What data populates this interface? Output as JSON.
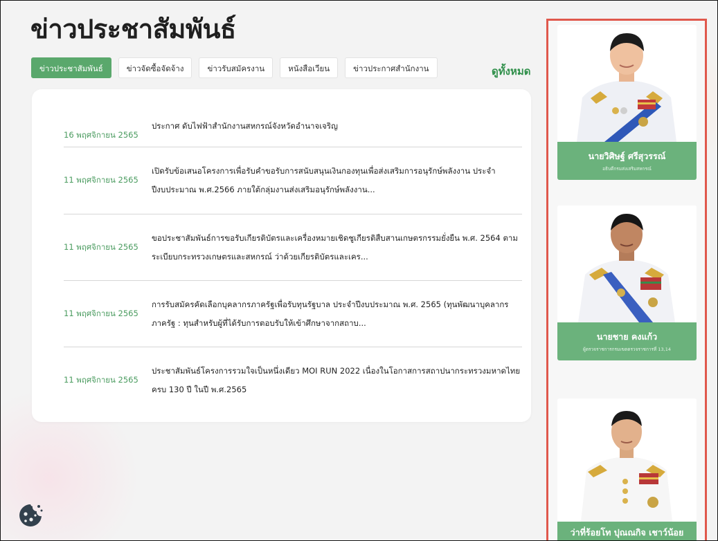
{
  "page": {
    "title": "ข่าวประชาสัมพันธ์",
    "see_all": "ดูทั้งหมด"
  },
  "tabs": [
    {
      "label": "ข่าวประชาสัมพันธ์",
      "active": true
    },
    {
      "label": "ข่าวจัดซื้อจัดจ้าง",
      "active": false
    },
    {
      "label": "ข่าวรับสมัครงาน",
      "active": false
    },
    {
      "label": "หนังสือเวียน",
      "active": false
    },
    {
      "label": "ข่าวประกาศสำนักงาน",
      "active": false
    }
  ],
  "news": [
    {
      "date": "16 พฤศจิกายน 2565",
      "title": "ประกาศ ดับไฟฟ้าสำนักงานสหกรณ์จังหวัดอำนาจเจริญ"
    },
    {
      "date": "11 พฤศจิกายน 2565",
      "title": "เปิดรับข้อเสนอโครงการเพื่อรับคำขอรับการสนับสนุนเงินกองทุนเพื่อส่งเสริมการอนุรักษ์พลังงาน ประจำปีงบประมาณ พ.ศ.2566 ภายใต้กลุ่มงานส่งเสริมอนุรักษ์พลังงาน..."
    },
    {
      "date": "11 พฤศจิกายน 2565",
      "title": "ขอประชาสัมพันธ์การขอรับเกียรติบัตรและเครื่องหมายเชิดชูเกียรติสืบสานเกษตรกรรมยั่งยืน พ.ศ. 2564 ตามระเบียบกระทรวงเกษตรและสหกรณ์ ว่าด้วยเกียรติบัตรและเคร..."
    },
    {
      "date": "11 พฤศจิกายน 2565",
      "title": "การรับสมัครคัดเลือกบุคลากรภาครัฐเพื่อรับทุนรัฐบาล ประจำปีงบประมาณ พ.ศ. 2565 (ทุนพัฒนาบุคลากรภาครัฐ : ทุนสำหรับผู้ที่ได้รับการตอบรับให้เข้าศึกษาจากสถาบ..."
    },
    {
      "date": "11 พฤศจิกายน 2565",
      "title": "ประชาสัมพันธ์โครงการรวมใจเป็นหนึ่งเดียว MOI RUN 2022 เนื่องในโอกาสการสถาปนากระทรวงมหาดไทยครบ 130 ปี ในปี พ.ศ.2565"
    }
  ],
  "people": [
    {
      "name": "นายวิศิษฐ์ ศรีสุวรรณ์",
      "position": "อธิบดีกรมส่งเสริมสหกรณ์"
    },
    {
      "name": "นายชาย คงแก้ว",
      "position": "ผู้ตรวจราชการกรมเขตตรวจราชการที่ 13,14"
    },
    {
      "name": "ว่าที่ร้อยโท ปุณณกิจ เชาว์น้อย",
      "position": ""
    }
  ],
  "colors": {
    "accent_green": "#5aa86c",
    "name_bar_green": "#6bb27c",
    "highlight_border": "#e0584c"
  },
  "icons": {
    "cookie": "cookie-icon"
  }
}
